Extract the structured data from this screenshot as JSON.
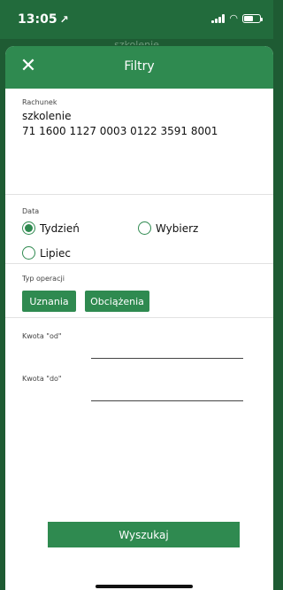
{
  "status_bar": {
    "time": "13:05",
    "nav_glyph": "↗"
  },
  "background_title": "szkolenie",
  "header": {
    "close_glyph": "✕",
    "title": "Filtry"
  },
  "account": {
    "label": "Rachunek",
    "name": "szkolenie",
    "number": "71 1600 1127 0003 0122 3591 8001"
  },
  "date": {
    "label": "Data",
    "options": [
      {
        "label": "Tydzień",
        "selected": true
      },
      {
        "label": "Wybierz",
        "selected": false
      },
      {
        "label": "Lipiec",
        "selected": false
      }
    ]
  },
  "operation_type": {
    "label": "Typ operacji",
    "buttons": [
      "Uznania",
      "Obciążenia"
    ]
  },
  "amount_from": {
    "label": "Kwota \"od\"",
    "value": ""
  },
  "amount_to": {
    "label": "Kwota \"do\"",
    "value": ""
  },
  "search_button": "Wyszukaj",
  "colors": {
    "primary": "#2f8a50",
    "status_bar": "#226b3c"
  }
}
